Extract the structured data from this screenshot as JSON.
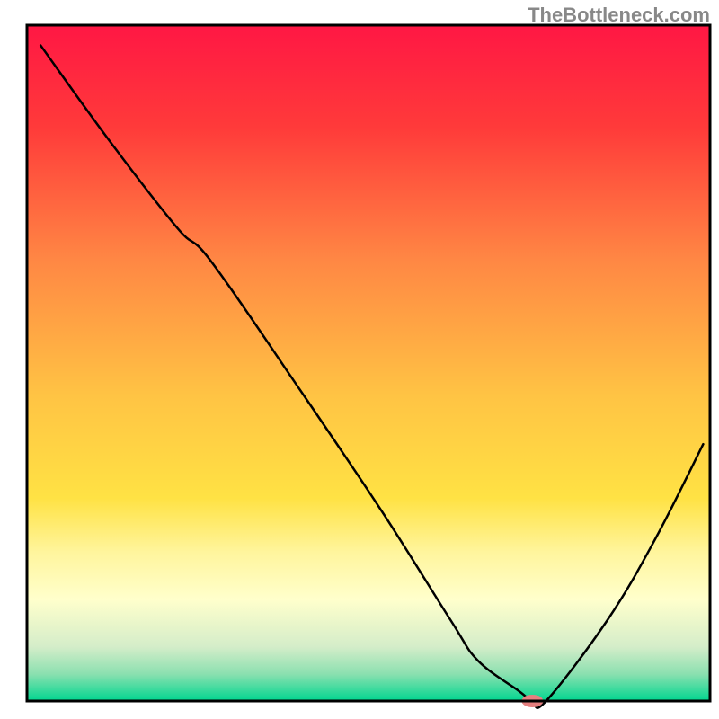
{
  "watermark": "TheBottleneck.com",
  "chart_data": {
    "type": "line",
    "title": "",
    "xlabel": "",
    "ylabel": "",
    "xlim": [
      0,
      100
    ],
    "ylim": [
      0,
      100
    ],
    "background": {
      "type": "vertical-gradient",
      "stops": [
        {
          "offset": 0.0,
          "color": "#ff1744"
        },
        {
          "offset": 0.15,
          "color": "#ff3a3a"
        },
        {
          "offset": 0.35,
          "color": "#ff8844"
        },
        {
          "offset": 0.55,
          "color": "#ffc444"
        },
        {
          "offset": 0.7,
          "color": "#ffe244"
        },
        {
          "offset": 0.78,
          "color": "#fff59d"
        },
        {
          "offset": 0.85,
          "color": "#ffffcc"
        },
        {
          "offset": 0.92,
          "color": "#d4edc9"
        },
        {
          "offset": 0.96,
          "color": "#8be0b0"
        },
        {
          "offset": 1.0,
          "color": "#00d68f"
        }
      ]
    },
    "series": [
      {
        "name": "bottleneck-curve",
        "type": "line",
        "color": "#000000",
        "width": 2.5,
        "x": [
          2,
          12,
          22,
          27,
          40,
          52,
          62,
          66,
          72,
          74,
          76,
          85,
          92,
          99
        ],
        "values": [
          97,
          83,
          70,
          65,
          46,
          28,
          12,
          6,
          1.5,
          0.0,
          0.0,
          12,
          24,
          38
        ]
      }
    ],
    "marker": {
      "name": "optimal-point",
      "x": 74,
      "y": 0.0,
      "color": "#e57f7f",
      "rx": 12,
      "ry": 7
    },
    "axes": {
      "show_border": true,
      "border_color": "#000000",
      "border_width": 3,
      "show_ticks": false,
      "show_grid": false
    }
  }
}
